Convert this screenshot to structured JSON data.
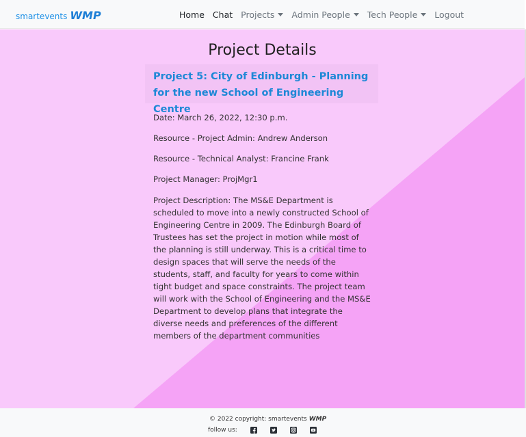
{
  "brand": {
    "text": "smartevents",
    "mark": "WMP"
  },
  "nav": [
    {
      "label": "Home",
      "dropdown": false
    },
    {
      "label": "Chat",
      "dropdown": false
    },
    {
      "label": "Projects",
      "dropdown": true
    },
    {
      "label": "Admin People",
      "dropdown": true
    },
    {
      "label": "Tech People",
      "dropdown": true
    },
    {
      "label": "Logout",
      "dropdown": false
    }
  ],
  "page": {
    "title": "Project Details",
    "project_title": "Project 5: City of Edinburgh - Planning for the new School of Engineering Centre",
    "date": "Date: March 26, 2022, 12:30 p.m.",
    "project_admin": "Resource - Project Admin: Andrew Anderson",
    "technical_analyst": "Resource - Technical Analyst: Francine Frank",
    "project_manager": "Project Manager: ProjMgr1",
    "description": "Project Description: The MS&E Department is scheduled to move into a newly constructed School of Engineering Centre in 2009. The Edinburgh Board of Trustees has set the project in motion while most of the planning is still underway. This is a critical time to design spaces that will serve the needs of the students, staff, and faculty for years to come within tight budget and space constraints. The project team will work with the School of Engineering and the MS&E Department to develop plans that integrate the diverse needs and preferences of the different members of the department communities"
  },
  "footer": {
    "copyright": "© 2022 copyright: smartevents",
    "copyright_mark": "WMP",
    "follow": "follow us:",
    "social_icons": [
      "facebook-icon",
      "twitter-icon",
      "instagram-icon",
      "youtube-icon"
    ]
  },
  "colors": {
    "background_light": "#f9c9fb",
    "background_dark": "#f5a3f6",
    "brand_blue": "#1e88d6"
  }
}
